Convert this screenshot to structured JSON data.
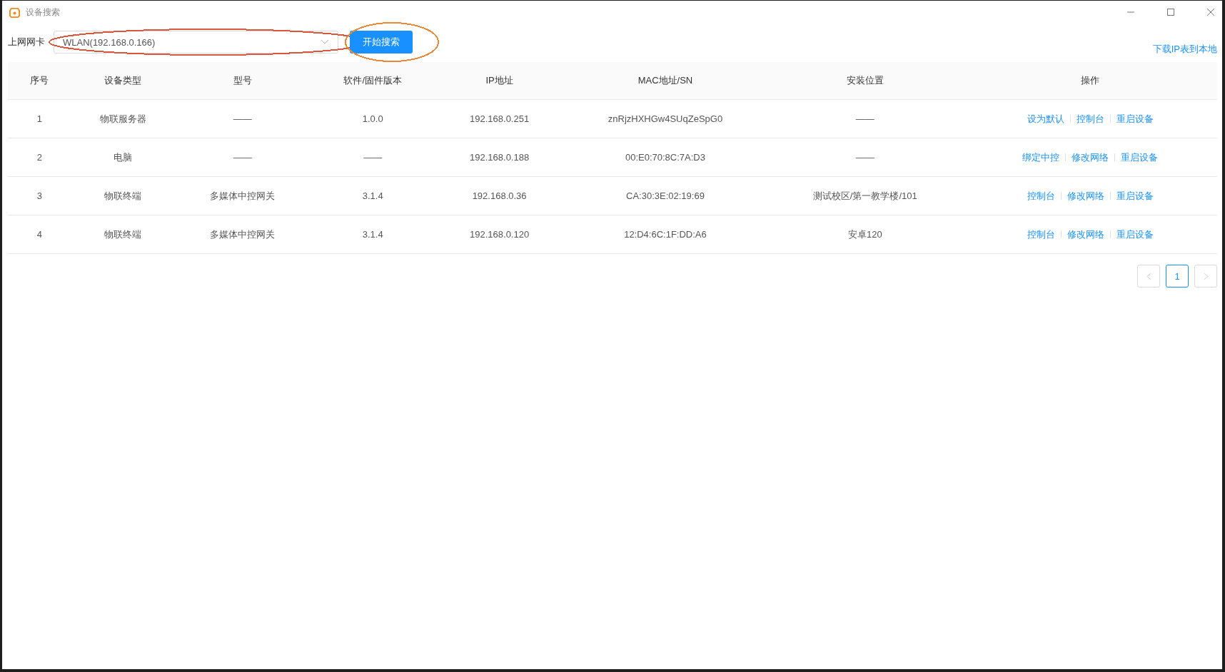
{
  "window": {
    "title": "设备搜索"
  },
  "toolbar": {
    "label": "上网网卡",
    "select": {
      "value": "WLAN(192.168.0.166)",
      "highlight": {
        "color": "#d9573b"
      }
    },
    "button": {
      "label": "开始搜索",
      "highlight": {
        "color": "#e8893a"
      }
    },
    "download_link": "下载IP表到本地"
  },
  "table": {
    "columns": [
      "序号",
      "设备类型",
      "型号",
      "软件/固件版本",
      "IP地址",
      "MAC地址/SN",
      "安装位置",
      "操作"
    ],
    "rows": [
      {
        "cells": [
          "1",
          "物联服务器",
          "——",
          "1.0.0",
          "192.168.0.251",
          "znRjzHXHGw4SUqZeSpG0",
          "——"
        ],
        "actions": [
          "设为默认",
          "控制台",
          "重启设备"
        ]
      },
      {
        "cells": [
          "2",
          "电脑",
          "——",
          "——",
          "192.168.0.188",
          "00:E0:70:8C:7A:D3",
          "——"
        ],
        "actions": [
          "绑定中控",
          "修改网络",
          "重启设备"
        ]
      },
      {
        "cells": [
          "3",
          "物联终端",
          "多媒体中控网关",
          "3.1.4",
          "192.168.0.36",
          "CA:30:3E:02:19:69",
          "测试校区/第一教学楼/101"
        ],
        "actions": [
          "控制台",
          "修改网络",
          "重启设备"
        ]
      },
      {
        "cells": [
          "4",
          "物联终端",
          "多媒体中控网关",
          "3.1.4",
          "192.168.0.120",
          "12:D4:6C:1F:DD:A6",
          "安卓120"
        ],
        "actions": [
          "控制台",
          "修改网络",
          "重启设备"
        ]
      }
    ]
  },
  "pagination": {
    "pages": [
      {
        "label": "1",
        "selected": true
      }
    ]
  }
}
